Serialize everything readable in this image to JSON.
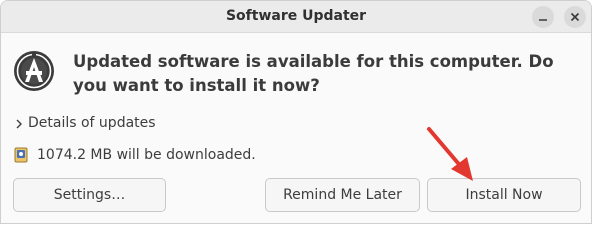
{
  "window": {
    "title": "Software Updater",
    "minimize_icon": "minimize-icon",
    "close_icon": "close-icon"
  },
  "message": {
    "icon": "software-updater-icon",
    "headline": "Updated software is available for this computer. Do you want to install it now?"
  },
  "details": {
    "icon": "chevron-right-icon",
    "label": "Details of updates"
  },
  "download": {
    "icon": "package-icon",
    "text": "1074.2 MB will be downloaded."
  },
  "buttons": {
    "settings": "Settings…",
    "remind": "Remind Me Later",
    "install": "Install Now"
  },
  "annotation": {
    "icon": "red-arrow-icon",
    "color": "#e2382f"
  }
}
